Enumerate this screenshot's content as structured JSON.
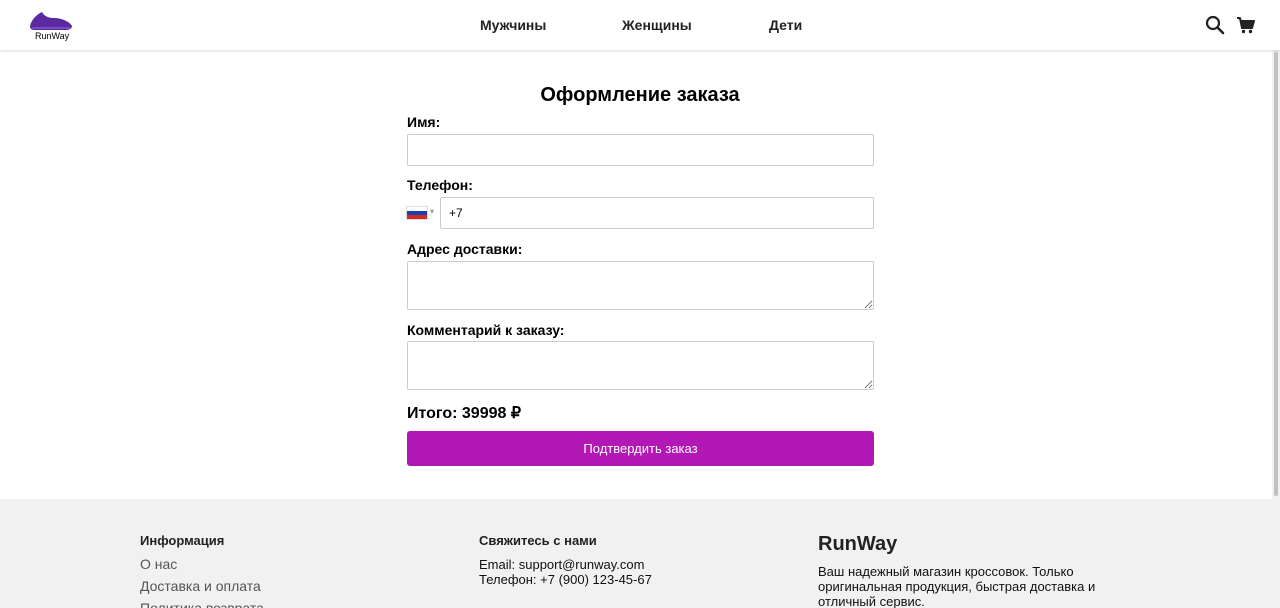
{
  "header": {
    "logo_text": "RunWay",
    "nav": [
      "Мужчины",
      "Женщины",
      "Дети"
    ],
    "icons": [
      "search-icon",
      "cart-icon"
    ]
  },
  "form": {
    "title": "Оформление заказа",
    "name_label": "Имя:",
    "name_value": "",
    "phone_label": "Телефон:",
    "phone_value": "+7",
    "phone_country": "RU",
    "address_label": "Адрес доставки:",
    "address_value": "",
    "comment_label": "Комментарий к заказу:",
    "comment_value": "",
    "total": "Итого: 39998 ₽",
    "submit_label": "Подтвердить заказ"
  },
  "footer": {
    "info": {
      "heading": "Информация",
      "links": [
        "О нас",
        "Доставка и оплата",
        "Политика возврата"
      ]
    },
    "contacts": {
      "heading": "Свяжитесь с нами",
      "email": "Email: support@runway.com",
      "phone": "Телефон: +7 (900) 123-45-67"
    },
    "brand": {
      "name": "RunWay",
      "description": "Ваш надежный магазин кроссовок. Только оригинальная продукция, быстрая доставка и отличный сервис."
    }
  },
  "colors": {
    "accent": "#b218b4",
    "logo": "#5b2a9e",
    "footer_bg": "#f1f1f1"
  }
}
